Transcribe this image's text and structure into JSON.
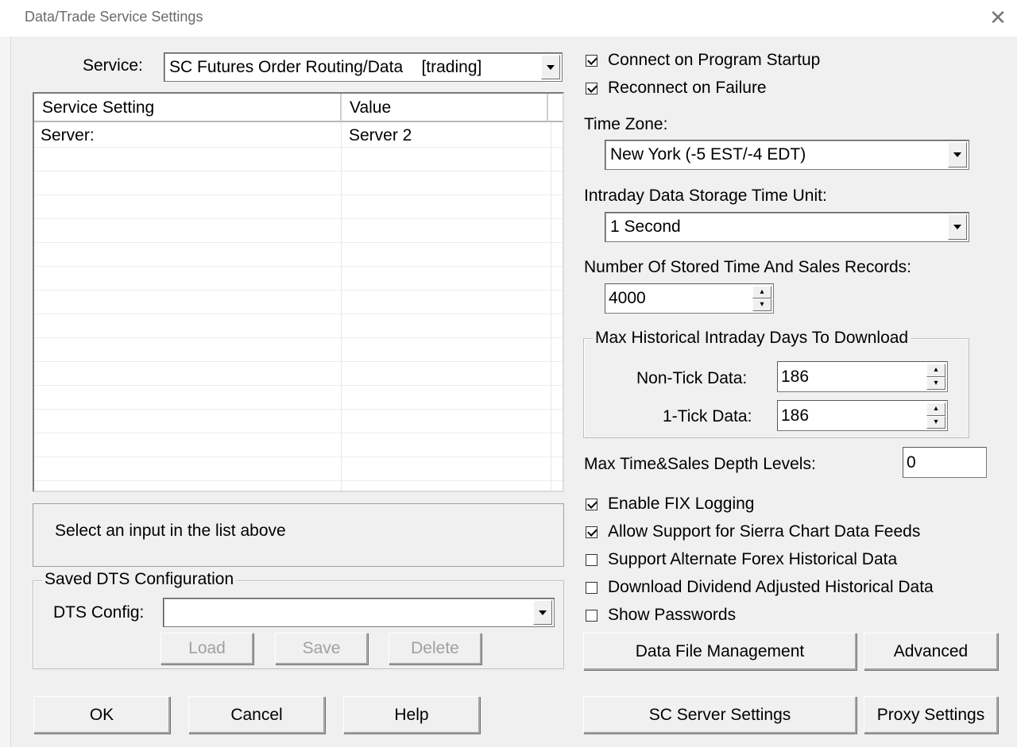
{
  "window": {
    "title": "Data/Trade Service Settings",
    "close_glyph": "✕"
  },
  "service": {
    "label": "Service:",
    "value": "SC Futures Order Routing/Data    [trading]"
  },
  "settings_list": {
    "columns": [
      "Service Setting",
      "Value"
    ],
    "rows": [
      {
        "setting": "Server:",
        "value": "Server 2"
      }
    ]
  },
  "info_text": "Select an input in the list above",
  "saved_dts": {
    "group_title": "Saved DTS Configuration",
    "config_label": "DTS Config:",
    "config_value": "",
    "load_label": "Load",
    "save_label": "Save",
    "delete_label": "Delete"
  },
  "connection": {
    "connect_on_startup": {
      "label": "Connect on Program Startup",
      "checked": true
    },
    "reconnect_on_failure": {
      "label": "Reconnect on Failure",
      "checked": true
    }
  },
  "time_zone": {
    "label": "Time Zone:",
    "value": "New York (-5 EST/-4 EDT)"
  },
  "intraday_unit": {
    "label": "Intraday Data Storage Time Unit:",
    "value": "1 Second"
  },
  "time_sales_records": {
    "label": "Number Of Stored Time And Sales Records:",
    "value": "4000"
  },
  "max_historical": {
    "group_title": "Max Historical Intraday Days To Download",
    "non_tick_label": "Non-Tick Data:",
    "non_tick_value": "186",
    "one_tick_label": "1-Tick Data:",
    "one_tick_value": "186"
  },
  "depth_levels": {
    "label": "Max Time&Sales Depth Levels:",
    "value": "0"
  },
  "options": {
    "enable_fix_logging": {
      "label": "Enable FIX Logging",
      "checked": true
    },
    "allow_sierra_feeds": {
      "label": "Allow Support for Sierra Chart Data Feeds",
      "checked": true
    },
    "alt_forex": {
      "label": "Support Alternate Forex Historical Data",
      "checked": false
    },
    "dividend_adjusted": {
      "label": "Download Dividend Adjusted Historical Data",
      "checked": false
    },
    "show_passwords": {
      "label": "Show Passwords",
      "checked": false
    }
  },
  "buttons": {
    "data_file_management": "Data File Management",
    "advanced": "Advanced",
    "sc_server_settings": "SC Server Settings",
    "proxy_settings": "Proxy Settings",
    "ok": "OK",
    "cancel": "Cancel",
    "help": "Help"
  }
}
